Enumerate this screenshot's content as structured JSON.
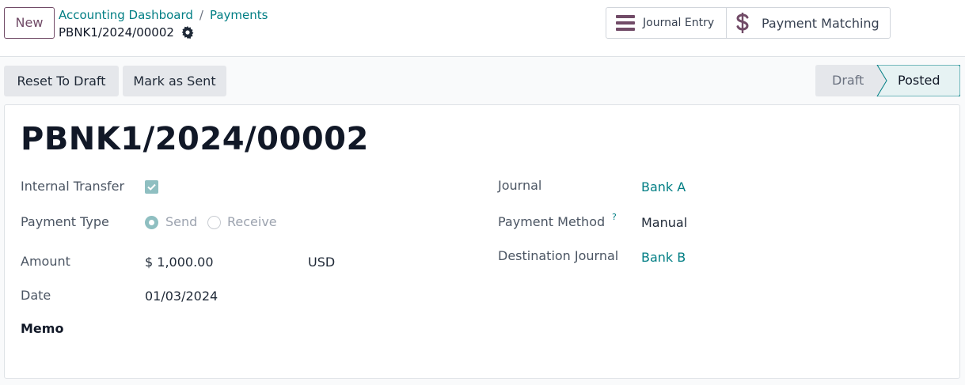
{
  "header": {
    "new_label": "New",
    "breadcrumb": [
      "Accounting Dashboard",
      "Payments"
    ],
    "breadcrumb_separator": "/",
    "record_name": "PBNK1/2024/00002",
    "smart_buttons": {
      "journal_entry": "Journal Entry",
      "payment_matching": "Payment Matching"
    }
  },
  "actions": {
    "reset_to_draft": "Reset To Draft",
    "mark_as_sent": "Mark as Sent"
  },
  "statusbar": {
    "stages": [
      "Draft",
      "Posted"
    ],
    "current": "Posted"
  },
  "form": {
    "title": "PBNK1/2024/00002",
    "internal_transfer": {
      "label": "Internal Transfer",
      "checked": true
    },
    "payment_type": {
      "label": "Payment Type",
      "options": [
        "Send",
        "Receive"
      ],
      "selected": "Send"
    },
    "amount": {
      "label": "Amount",
      "value": "$ 1,000.00",
      "currency": "USD"
    },
    "date": {
      "label": "Date",
      "value": "01/03/2024"
    },
    "memo": {
      "label": "Memo",
      "value": ""
    },
    "journal": {
      "label": "Journal",
      "value": "Bank A"
    },
    "payment_method": {
      "label": "Payment Method",
      "help": "?",
      "value": "Manual"
    },
    "destination_journal": {
      "label": "Destination Journal",
      "value": "Bank B"
    }
  },
  "colors": {
    "brand": "#714b67",
    "link": "#017e84",
    "checkbox_fill": "#8fbfc1"
  },
  "icons": {
    "journal_entry": "list-bars-icon",
    "payment_matching": "dollar-icon",
    "record_settings": "gear-icon"
  }
}
